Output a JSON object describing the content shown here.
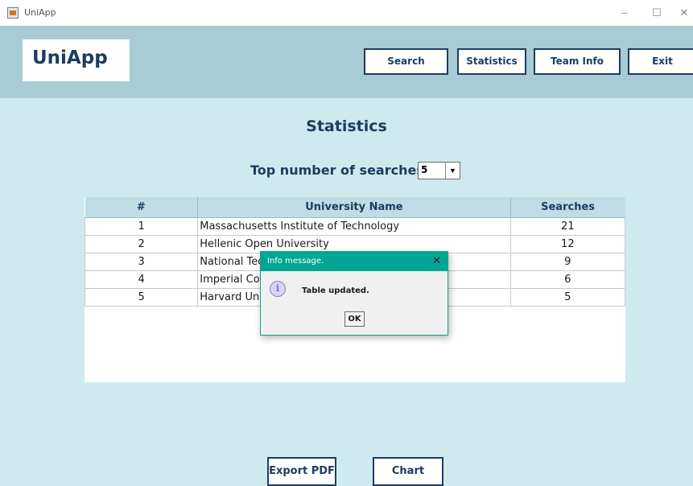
{
  "window": {
    "title": "UniApp",
    "minimize": "–",
    "maximize": "☐",
    "close": "✕"
  },
  "header": {
    "logo": "UniApp",
    "nav": {
      "search": "Search",
      "statistics": "Statistics",
      "team_info": "Team Info",
      "exit": "Exit"
    }
  },
  "main": {
    "title": "Statistics",
    "top_label": "Top number of searches:",
    "top_value": "5",
    "table": {
      "headers": [
        "#",
        "University Name",
        "Searches"
      ],
      "rows": [
        [
          "1",
          "Massachusetts Institute of Technology",
          "21"
        ],
        [
          "2",
          "Hellenic Open University",
          "12"
        ],
        [
          "3",
          "National Technical University of Athens",
          "9"
        ],
        [
          "4",
          "Imperial College London",
          "6"
        ],
        [
          "5",
          "Harvard University",
          "5"
        ]
      ]
    },
    "buttons": {
      "export_pdf": "Export PDF",
      "chart": "Chart"
    }
  },
  "dialog": {
    "title": "Info message.",
    "close": "✕",
    "icon": "i",
    "message": "Table updated.",
    "ok": "OK"
  },
  "colors": {
    "header_bg": "#a9cbd6",
    "main_bg": "#cfeaee",
    "brand": "#1c3c60",
    "dialog_accent": "#00a693"
  }
}
